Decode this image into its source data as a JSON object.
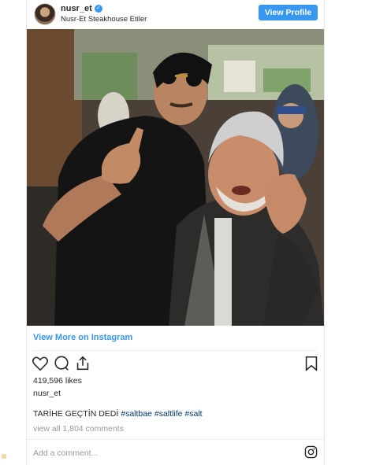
{
  "header": {
    "username": "nusr_et",
    "location": "Nusr-Et Steakhouse Etiler",
    "view_profile_label": "View Profile",
    "verified_icon": "verified-badge-icon"
  },
  "photo": {
    "description_icon": "post-photo"
  },
  "links": {
    "view_more_label": "View More on Instagram"
  },
  "actions": {
    "icons": [
      "heart-icon",
      "comment-icon",
      "share-icon",
      "bookmark-icon"
    ]
  },
  "stats": {
    "likes_text": "419,596 likes"
  },
  "post": {
    "poster": "nusr_et",
    "caption_text": "TARİHE GEÇTİN DEDİ ",
    "hashtags": [
      "#saltbae",
      "#saltlife",
      "#salt"
    ],
    "comments_link": "view all 1,804 comments"
  },
  "footer": {
    "add_comment_placeholder": "Add a comment...",
    "logo_icon": "instagram-icon"
  },
  "colors": {
    "accent": "#3897f0",
    "hashtag": "#003569",
    "muted": "#999999"
  }
}
